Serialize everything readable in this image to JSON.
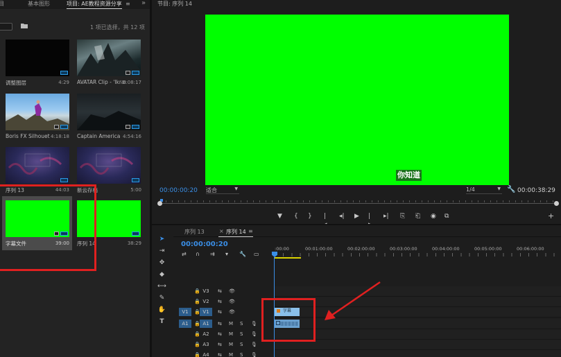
{
  "project_panel": {
    "tabs": [
      "书目",
      "基本图形",
      "项目: AE教程资源分享"
    ],
    "tab_menu_glyph": "≡",
    "tab_more_glyph": "»",
    "selection_count": "1 项已选择，共 12 项",
    "items": [
      {
        "name": "调整图层",
        "duration": "4:29"
      },
      {
        "name": "AVATAR Clip - 'Ikran...",
        "duration": "5:08:17"
      },
      {
        "name": "Boris FX Silhouette...",
        "duration": "4:18:18"
      },
      {
        "name": "Captain America 'A...",
        "duration": "4:54:16"
      },
      {
        "name": "序列 13",
        "duration": "44:03"
      },
      {
        "name": "新云存档",
        "duration": "5:00"
      },
      {
        "name": "字幕文件",
        "duration": "39:00"
      },
      {
        "name": "序列 14",
        "duration": "38:29"
      }
    ],
    "thumb_text": "一键抠图\n抠像神器"
  },
  "program_monitor": {
    "title": "节目: 序列 14",
    "caption_text": "你知道",
    "timecode_current": "00:00:00:20",
    "fit_label": "适合",
    "resolution_label": "1/4",
    "timecode_duration": "00:00:38:29",
    "transport_glyphs": [
      "▼",
      "{",
      "}",
      "|◂",
      "◂|",
      "▶",
      "|▸",
      "▸|",
      "⎘",
      "⎗",
      "◉",
      "⧉"
    ],
    "add_button": "+"
  },
  "timeline": {
    "tabs": [
      "序列 13",
      "序列 14"
    ],
    "close_glyph": "×",
    "menu_glyph": "≡",
    "timecode": "00:00:00:20",
    "header_icons": [
      "⇄",
      "∩",
      "⇉",
      "▾",
      "🔧",
      "▭"
    ],
    "ruler_labels": [
      ":00:00",
      "00:01:00:00",
      "00:02:00:00",
      "00:03:00:00",
      "00:04:00:00",
      "00:05:00:00",
      "00:06:00:00"
    ],
    "tracks": [
      {
        "target": "V3",
        "source": "",
        "icons": [
          "⇆",
          "👁"
        ]
      },
      {
        "target": "V2",
        "source": "",
        "icons": [
          "⇆",
          "👁"
        ]
      },
      {
        "target": "V1",
        "source": "V1",
        "icons": [
          "⇆",
          "👁"
        ]
      },
      {
        "target": "A1",
        "source": "A1",
        "icons": [
          "⇆",
          "M",
          "S",
          "🎙"
        ]
      },
      {
        "target": "A2",
        "source": "",
        "icons": [
          "⇆",
          "M",
          "S",
          "🎙"
        ]
      },
      {
        "target": "A3",
        "source": "",
        "icons": [
          "⇆",
          "M",
          "S",
          "🎙"
        ]
      },
      {
        "target": "A4",
        "source": "",
        "icons": [
          "⇆",
          "M",
          "S",
          "🎙"
        ]
      }
    ],
    "caption_clip_label": "字幕"
  },
  "colors": {
    "accent": "#3a8ee6",
    "green_screen": "#00ff00",
    "annotation_red": "#e02020"
  }
}
